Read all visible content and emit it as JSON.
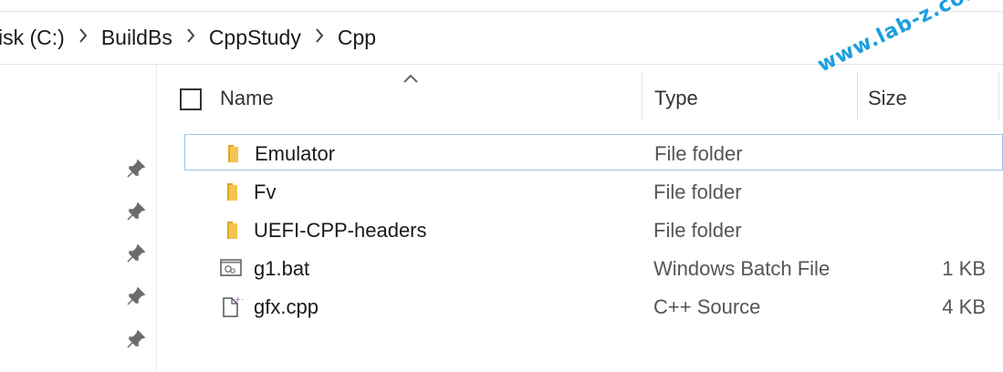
{
  "address_bar": {
    "crumbs": [
      "isk (C:)",
      "BuildBs",
      "CppStudy",
      "Cpp"
    ],
    "separator_icon": "chevron-right-icon"
  },
  "quick_access": {
    "pin_icon": "pin-icon",
    "pin_count": 5
  },
  "columns": {
    "name": "Name",
    "type": "Type",
    "size": "Size",
    "sorted_by": "Name",
    "sort_icon": "chevron-up-icon"
  },
  "files": [
    {
      "name": "Emulator",
      "type": "File folder",
      "size": "",
      "icon": "folder-icon",
      "selected": true
    },
    {
      "name": "Fv",
      "type": "File folder",
      "size": "",
      "icon": "folder-icon",
      "selected": false
    },
    {
      "name": "UEFI-CPP-headers",
      "type": "File folder",
      "size": "",
      "icon": "folder-icon",
      "selected": false
    },
    {
      "name": "g1.bat",
      "type": "Windows Batch File",
      "size": "1 KB",
      "icon": "batch-file-icon",
      "selected": false
    },
    {
      "name": "gfx.cpp",
      "type": "C++ Source",
      "size": "4 KB",
      "icon": "cpp-file-icon",
      "selected": false
    }
  ],
  "watermark": "www.lab-z.com",
  "colors": {
    "selection_border": "#9ec6ea",
    "folder": "#f3c44f",
    "watermark": "#1a9ee0"
  }
}
